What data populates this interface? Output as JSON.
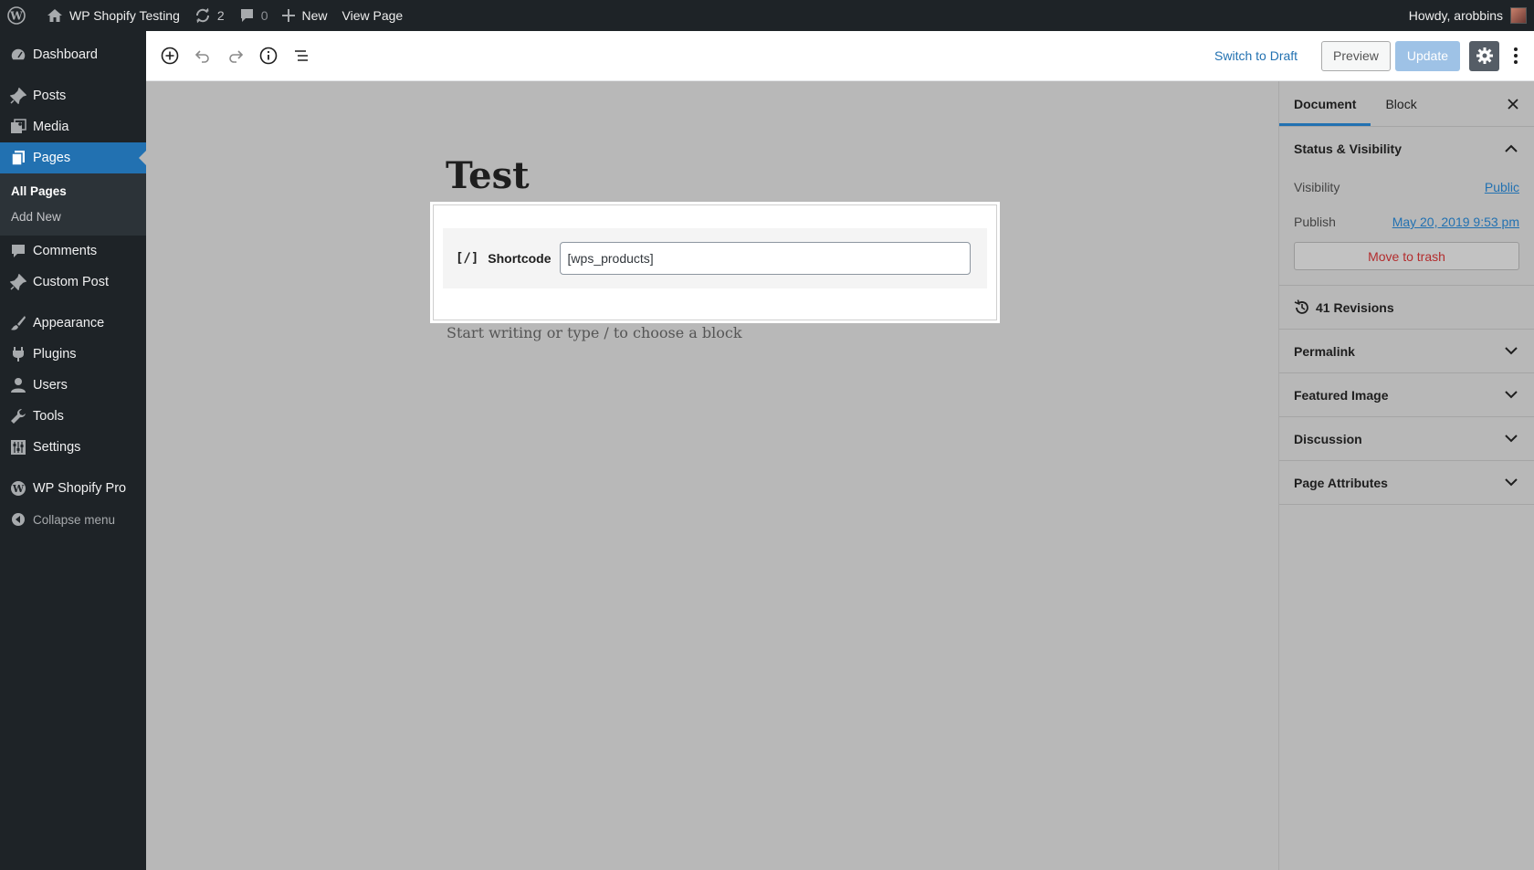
{
  "adminbar": {
    "site_name": "WP Shopify Testing",
    "updates_count": "2",
    "comments_count": "0",
    "new_label": "New",
    "view_label": "View Page",
    "greeting": "Howdy, arobbins"
  },
  "sidebar": {
    "items": [
      {
        "label": "Dashboard",
        "icon": "dashboard-icon"
      },
      {
        "label": "Posts",
        "icon": "pin-icon"
      },
      {
        "label": "Media",
        "icon": "media-icon"
      },
      {
        "label": "Pages",
        "icon": "pages-icon"
      },
      {
        "label": "Comments",
        "icon": "comment-icon"
      },
      {
        "label": "Custom Post",
        "icon": "pin-icon"
      },
      {
        "label": "Appearance",
        "icon": "brush-icon"
      },
      {
        "label": "Plugins",
        "icon": "plug-icon"
      },
      {
        "label": "Users",
        "icon": "user-icon"
      },
      {
        "label": "Tools",
        "icon": "wrench-icon"
      },
      {
        "label": "Settings",
        "icon": "settings-icon"
      },
      {
        "label": "WP Shopify Pro",
        "icon": "wp-logo-icon"
      }
    ],
    "submenu": [
      "All Pages",
      "Add New"
    ],
    "collapse_label": "Collapse menu"
  },
  "toolbar": {
    "switch_draft": "Switch to Draft",
    "preview": "Preview",
    "update": "Update"
  },
  "editor": {
    "title": "Test",
    "block": {
      "icon_text": "[/]",
      "label": "Shortcode",
      "value": "[wps_products]"
    },
    "appender": "Start writing or type / to choose a block"
  },
  "settings": {
    "tabs": [
      "Document",
      "Block"
    ],
    "status_title": "Status & Visibility",
    "visibility_label": "Visibility",
    "visibility_value": "Public",
    "publish_label": "Publish",
    "publish_value": "May 20, 2019 9:53 pm",
    "trash_label": "Move to trash",
    "revisions": "41 Revisions",
    "panels": [
      "Permalink",
      "Featured Image",
      "Discussion",
      "Page Attributes"
    ]
  },
  "colors": {
    "accent": "#2271b1",
    "admin_dark": "#1e2327",
    "canvas_overlay": "#b8b8b8",
    "trash": "#b32d2e"
  }
}
